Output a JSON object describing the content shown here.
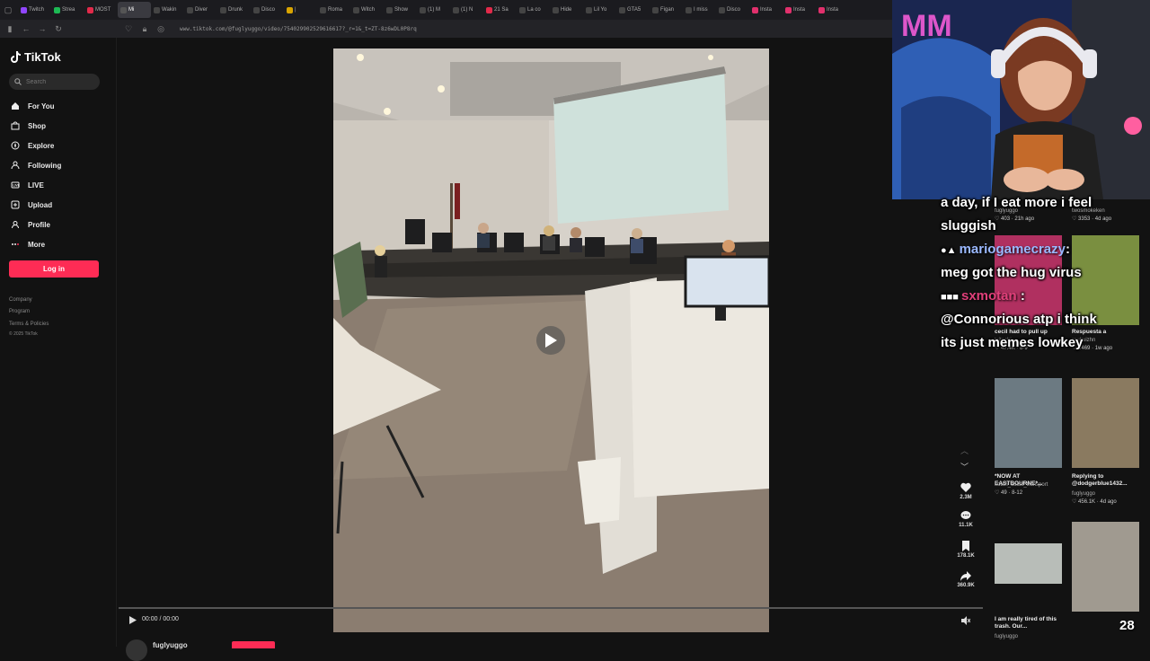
{
  "browser": {
    "tabs": [
      {
        "label": "Twitch",
        "color": "#9146ff"
      },
      {
        "label": "Strea",
        "color": "#1db954"
      },
      {
        "label": "MOST",
        "color": "#e22a4a"
      },
      {
        "label": "Mi",
        "color": "#555555",
        "active": true
      },
      {
        "label": "Wakin",
        "color": "#444444"
      },
      {
        "label": "Diver",
        "color": "#444444"
      },
      {
        "label": "Drunk",
        "color": "#444444"
      },
      {
        "label": "Disco",
        "color": "#444444"
      },
      {
        "label": "| ",
        "color": "#d9a400"
      },
      {
        "label": "Roma",
        "color": "#444444"
      },
      {
        "label": "Witch",
        "color": "#444444"
      },
      {
        "label": "Show",
        "color": "#444444"
      },
      {
        "label": "(1) M",
        "color": "#444444"
      },
      {
        "label": "(1) N",
        "color": "#444444"
      },
      {
        "label": "21 Sa",
        "color": "#e22a4a"
      },
      {
        "label": "La co",
        "color": "#444444"
      },
      {
        "label": "Hide",
        "color": "#444444"
      },
      {
        "label": "Lil Yo",
        "color": "#444444"
      },
      {
        "label": "GTA5",
        "color": "#444444"
      },
      {
        "label": "Figan",
        "color": "#444444"
      },
      {
        "label": "I miss",
        "color": "#444444"
      },
      {
        "label": "Disco",
        "color": "#444444"
      },
      {
        "label": "Insta",
        "color": "#e1306c"
      },
      {
        "label": "Insta",
        "color": "#e1306c"
      },
      {
        "label": "Insta",
        "color": "#e1306c"
      }
    ],
    "url": "www.tiktok.com/@fuglyuggo/video/754029902529616617?_r=1&_t=ZT-8z6wDL0P8rq"
  },
  "sidebar": {
    "logo": "TikTok",
    "search_placeholder": "Search",
    "menu": [
      {
        "label": "For You",
        "icon": "home-icon"
      },
      {
        "label": "Shop",
        "icon": "shop-icon"
      },
      {
        "label": "Explore",
        "icon": "compass-icon"
      },
      {
        "label": "Following",
        "icon": "user-icon"
      },
      {
        "label": "LIVE",
        "icon": "live-icon"
      },
      {
        "label": "Upload",
        "icon": "plus-icon"
      },
      {
        "label": "Profile",
        "icon": "profile-icon"
      },
      {
        "label": "More",
        "icon": "more-icon"
      }
    ],
    "login_label": "Log in",
    "footer": [
      "Company",
      "Program",
      "Terms & Policies",
      "© 2025 TikTok"
    ]
  },
  "player": {
    "time": "00:00 / 00:00",
    "author": "fuglyuggo"
  },
  "actions": {
    "likes": "2.3M",
    "comments": "11.1K",
    "saves": "178.1K",
    "shares": "360.9K"
  },
  "thumbs": [
    {
      "caption": "",
      "user": "fuglyuggo",
      "likes": "403",
      "age": "21h ago"
    },
    {
      "caption": "",
      "user": "twosmokeken",
      "likes": "3353",
      "age": "4d ago"
    },
    {
      "caption": "cecil had to pull up",
      "user": "txitachi_",
      "likes": "47.4K",
      "age": "8-9"
    },
    {
      "caption": "Respuesta a",
      "user": "raulruizhn",
      "likes": "1469",
      "age": "1w ago"
    },
    {
      "caption": "*NOW AT EASTBOURNE*...",
      "user": "south_coast_transport",
      "likes": "49",
      "age": "8-12"
    },
    {
      "caption": "Replying to @dodgerblue1432...",
      "user": "fuglyuggo",
      "likes": "456.1K",
      "age": "4d ago"
    },
    {
      "caption": "I am really tired of this trash. Our...",
      "user": "fuglyuggo",
      "likes": "",
      "age": ""
    },
    {
      "caption": "",
      "user": "",
      "likes": "",
      "age": ""
    }
  ],
  "chat": {
    "line1": "a day, if I eat more i feel",
    "line2": "sluggish",
    "user1": "mariogamecrazy",
    "user1_color": "#9ab8ff",
    "msg1": "meg got the hug virus",
    "user2": "sxmotan",
    "user2_color": "#e0407a",
    "msg2a": "@Connorious atp i think",
    "msg2b": "its just memes lowkey"
  },
  "overlay_count": "28"
}
